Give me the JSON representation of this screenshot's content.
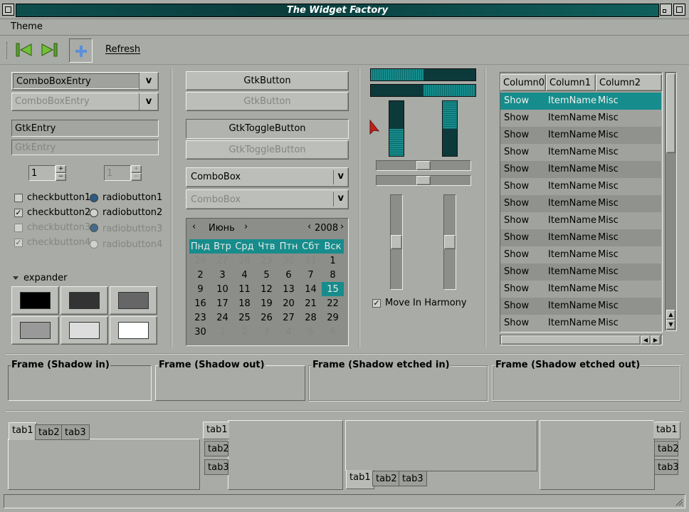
{
  "window": {
    "title": "The Widget Factory"
  },
  "menu": {
    "theme": "Theme"
  },
  "toolbar": {
    "refresh": "Refresh"
  },
  "left": {
    "combo_entry": "ComboBoxEntry",
    "combo_entry_disabled": "ComboBoxEntry",
    "entry": "GtkEntry",
    "entry_disabled": "GtkEntry",
    "spin1": "1",
    "spin2": "1",
    "check1": "checkbutton1",
    "check2": "checkbutton2",
    "check3": "checkbutton3",
    "check4": "checkbutton4",
    "radio1": "radiobutton1",
    "radio2": "radiobutton2",
    "radio3": "radiobutton3",
    "radio4": "radiobutton4",
    "expander": "expander",
    "swatches": [
      "#000000",
      "#333333",
      "#666666",
      "#999999",
      "#dddddd",
      "#ffffff"
    ]
  },
  "middle": {
    "button": "GtkButton",
    "button_disabled": "GtkButton",
    "toggle": "GtkToggleButton",
    "toggle_disabled": "GtkToggleButton",
    "combobox": "ComboBox",
    "combobox_disabled": "ComboBox",
    "accent": "#168c8c"
  },
  "calendar": {
    "month": "Июнь",
    "year": "2008",
    "days": [
      "Пнд",
      "Втр",
      "Срд",
      "Чтв",
      "Птн",
      "Сбт",
      "Вск"
    ],
    "weeks": [
      [
        "26",
        "27",
        "28",
        "29",
        "30",
        "31",
        "1"
      ],
      [
        "2",
        "3",
        "4",
        "5",
        "6",
        "7",
        "8"
      ],
      [
        "9",
        "10",
        "11",
        "12",
        "13",
        "14",
        "15"
      ],
      [
        "16",
        "17",
        "18",
        "19",
        "20",
        "21",
        "22"
      ],
      [
        "23",
        "24",
        "25",
        "26",
        "27",
        "28",
        "29"
      ],
      [
        "30",
        "1",
        "2",
        "3",
        "4",
        "5",
        "6"
      ]
    ],
    "selected": "15"
  },
  "ranges": {
    "progress_h1": 0.5,
    "progress_h2": 0.5,
    "progress_v1": 0.5,
    "progress_v2": 0.5,
    "scale_h1": 0.5,
    "scale_h2": 0.5,
    "scale_v1": 0.5,
    "scale_v2": 0.5,
    "harmony": "Move In Harmony"
  },
  "tree": {
    "columns": [
      "Column0",
      "Column1",
      "Column2"
    ],
    "rows": [
      [
        "Show",
        "ItemName",
        "Misc"
      ],
      [
        "Show",
        "ItemName",
        "Misc"
      ],
      [
        "Show",
        "ItemName",
        "Misc"
      ],
      [
        "Show",
        "ItemName",
        "Misc"
      ],
      [
        "Show",
        "ItemName",
        "Misc"
      ],
      [
        "Show",
        "ItemName",
        "Misc"
      ],
      [
        "Show",
        "ItemName",
        "Misc"
      ],
      [
        "Show",
        "ItemName",
        "Misc"
      ],
      [
        "Show",
        "ItemName",
        "Misc"
      ],
      [
        "Show",
        "ItemName",
        "Misc"
      ],
      [
        "Show",
        "ItemName",
        "Misc"
      ],
      [
        "Show",
        "ItemName",
        "Misc"
      ],
      [
        "Show",
        "ItemName",
        "Misc"
      ],
      [
        "Show",
        "ItemName",
        "Misc"
      ]
    ]
  },
  "frames": [
    "Frame (Shadow in)",
    "Frame (Shadow out)",
    "Frame (Shadow etched in)",
    "Frame (Shadow etched out)"
  ],
  "tabs": {
    "tab1": "tab1",
    "tab2": "tab2",
    "tab3": "tab3"
  }
}
